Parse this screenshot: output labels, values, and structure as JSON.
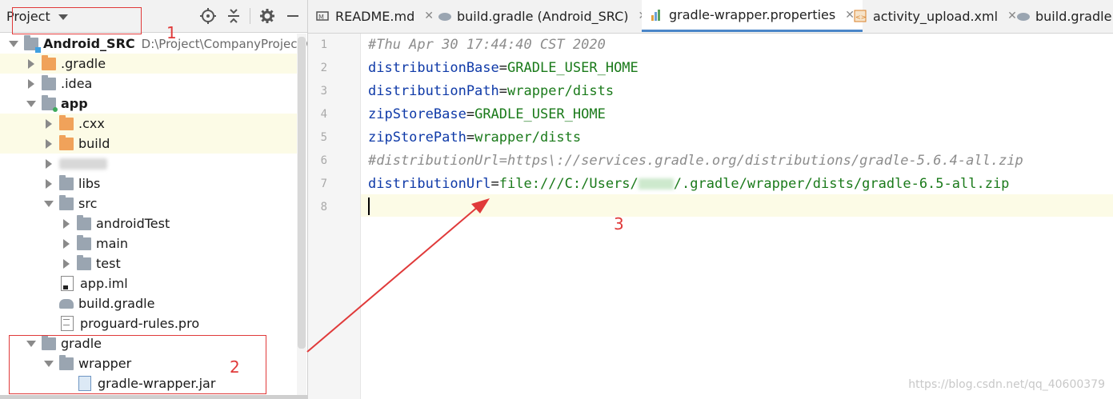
{
  "panel": {
    "view_label": "Project"
  },
  "tree": [
    {
      "label": "Android_SRC",
      "path": "D:\\Project\\CompanyProject\\GP",
      "depth": 0,
      "arrow": "down",
      "icon": "project-folder",
      "bold": true,
      "highlight": false
    },
    {
      "label": ".gradle",
      "depth": 1,
      "arrow": "right",
      "icon": "orange-folder",
      "bold": false,
      "highlight": true
    },
    {
      "label": ".idea",
      "depth": 1,
      "arrow": "right",
      "icon": "folder",
      "bold": false,
      "highlight": false
    },
    {
      "label": "app",
      "depth": 1,
      "arrow": "down",
      "icon": "module-folder",
      "bold": true,
      "highlight": false
    },
    {
      "label": ".cxx",
      "depth": 2,
      "arrow": "right",
      "icon": "orange-folder",
      "bold": false,
      "highlight": true
    },
    {
      "label": "build",
      "depth": 2,
      "arrow": "right",
      "icon": "orange-folder",
      "bold": false,
      "highlight": true
    },
    {
      "label": "",
      "depth": 2,
      "arrow": "right",
      "icon": "blurred",
      "bold": false,
      "highlight": false
    },
    {
      "label": "libs",
      "depth": 2,
      "arrow": "right",
      "icon": "folder",
      "bold": false,
      "highlight": false
    },
    {
      "label": "src",
      "depth": 2,
      "arrow": "down",
      "icon": "folder",
      "bold": false,
      "highlight": false
    },
    {
      "label": "androidTest",
      "depth": 3,
      "arrow": "right",
      "icon": "folder",
      "bold": false,
      "highlight": false
    },
    {
      "label": "main",
      "depth": 3,
      "arrow": "right",
      "icon": "folder",
      "bold": false,
      "highlight": false
    },
    {
      "label": "test",
      "depth": 3,
      "arrow": "right",
      "icon": "folder",
      "bold": false,
      "highlight": false
    },
    {
      "label": "app.iml",
      "depth": 2,
      "arrow": "none",
      "icon": "iml-file",
      "bold": false,
      "highlight": false
    },
    {
      "label": "build.gradle",
      "depth": 2,
      "arrow": "none",
      "icon": "gradle-elephant",
      "bold": false,
      "highlight": false
    },
    {
      "label": "proguard-rules.pro",
      "depth": 2,
      "arrow": "none",
      "icon": "pro-file",
      "bold": false,
      "highlight": false
    },
    {
      "label": "gradle",
      "depth": 1,
      "arrow": "down",
      "icon": "folder",
      "bold": false,
      "highlight": false
    },
    {
      "label": "wrapper",
      "depth": 2,
      "arrow": "down",
      "icon": "folder",
      "bold": false,
      "highlight": false
    },
    {
      "label": "gradle-wrapper.jar",
      "depth": 3,
      "arrow": "none",
      "icon": "jar-file",
      "bold": false,
      "highlight": false
    }
  ],
  "tabs": [
    {
      "label": "README.md",
      "icon": "markdown-icon",
      "active": false,
      "closable": true
    },
    {
      "label": "build.gradle (Android_SRC)",
      "icon": "gradle-elephant-icon",
      "active": false,
      "closable": true
    },
    {
      "label": "gradle-wrapper.properties",
      "icon": "properties-icon",
      "active": true,
      "closable": true
    },
    {
      "label": "activity_upload.xml",
      "icon": "xml-icon",
      "active": false,
      "closable": true
    },
    {
      "label": "build.gradle (",
      "icon": "gradle-elephant-icon",
      "active": false,
      "closable": false
    }
  ],
  "editor": {
    "line_numbers": [
      "1",
      "2",
      "3",
      "4",
      "5",
      "6",
      "7",
      "8"
    ],
    "lines": [
      [
        {
          "t": "#Thu Apr 30 17:44:40 CST 2020",
          "c": "c"
        }
      ],
      [
        {
          "t": "distributionBase",
          "c": "k"
        },
        {
          "t": "=",
          "c": "eq"
        },
        {
          "t": "GRADLE_USER_HOME",
          "c": "v"
        }
      ],
      [
        {
          "t": "distributionPath",
          "c": "k"
        },
        {
          "t": "=",
          "c": "eq"
        },
        {
          "t": "wrapper/dists",
          "c": "v"
        }
      ],
      [
        {
          "t": "zipStoreBase",
          "c": "k"
        },
        {
          "t": "=",
          "c": "eq"
        },
        {
          "t": "GRADLE_USER_HOME",
          "c": "v"
        }
      ],
      [
        {
          "t": "zipStorePath",
          "c": "k"
        },
        {
          "t": "=",
          "c": "eq"
        },
        {
          "t": "wrapper/dists",
          "c": "v"
        }
      ],
      [
        {
          "t": "#distributionUrl=https\\://services.gradle.org/distributions/gradle-5.6.4-all.zip",
          "c": "c"
        }
      ],
      [
        {
          "t": "distributionUrl",
          "c": "k"
        },
        {
          "t": "=",
          "c": "eq"
        },
        {
          "t": "file:///C:/Users/",
          "c": "v"
        },
        {
          "t": "",
          "c": "blur"
        },
        {
          "t": "/.gradle/wrapper/dists/gradle-6.5-all.zip",
          "c": "v"
        }
      ],
      []
    ],
    "current_line": "8"
  },
  "annotations": {
    "one": "1",
    "two": "2",
    "three": "3"
  },
  "watermark": "https://blog.csdn.net/qq_40600379",
  "colors": {
    "key": "#0f3aa8",
    "value": "#1a7a1a",
    "comment": "#8c8c8c",
    "annotation": "#e03a3a",
    "active_tab_underline": "#4a86c8",
    "highlight_row": "#fcfbe6"
  }
}
